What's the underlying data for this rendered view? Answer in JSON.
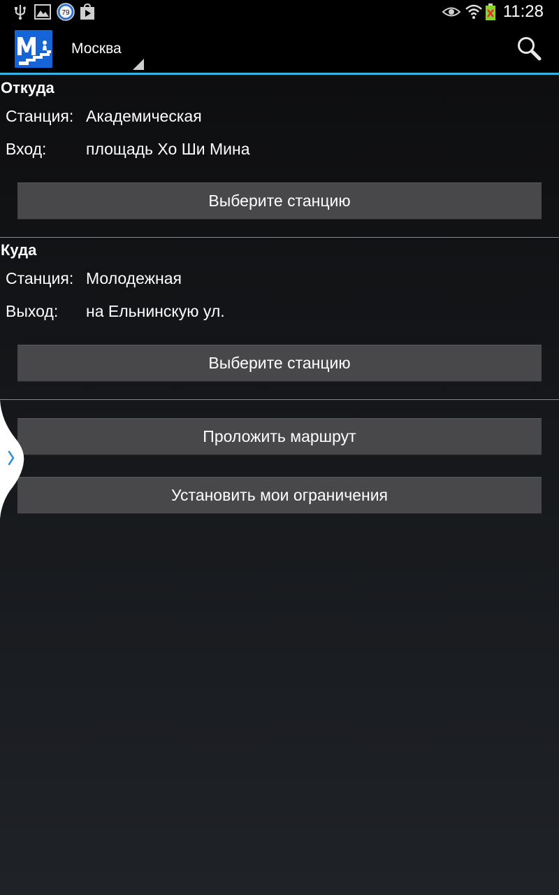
{
  "status_bar": {
    "time": "11:28",
    "notification_badge": "79",
    "icons_left": [
      "usb-icon",
      "image-icon",
      "badge-79-icon",
      "play-store-icon"
    ],
    "icons_right": [
      "eye-icon",
      "wifi-icon",
      "battery-icon"
    ]
  },
  "action_bar": {
    "logo_icon": "metro-logo-icon",
    "city": "Москва",
    "search_icon": "search-icon"
  },
  "from": {
    "title": "Откуда",
    "station_label": "Станция:",
    "station_value": "Академическая",
    "entrance_label": "Вход:",
    "entrance_value": "площадь Хо Ши Мина",
    "choose_button": "Выберите станцию"
  },
  "to": {
    "title": "Куда",
    "station_label": "Станция:",
    "station_value": "Молодежная",
    "exit_label": "Выход:",
    "exit_value": "на Ельнинскую ул.",
    "choose_button": "Выберите станцию"
  },
  "actions": {
    "route_button": "Проложить маршрут",
    "limits_button": "Установить мои ограничения"
  },
  "drawer": {
    "handle_icon": "chevron-right-icon"
  },
  "colors": {
    "accent": "#33b5e5",
    "logo_bg": "#1565d8",
    "button_bg": "#48484b"
  }
}
